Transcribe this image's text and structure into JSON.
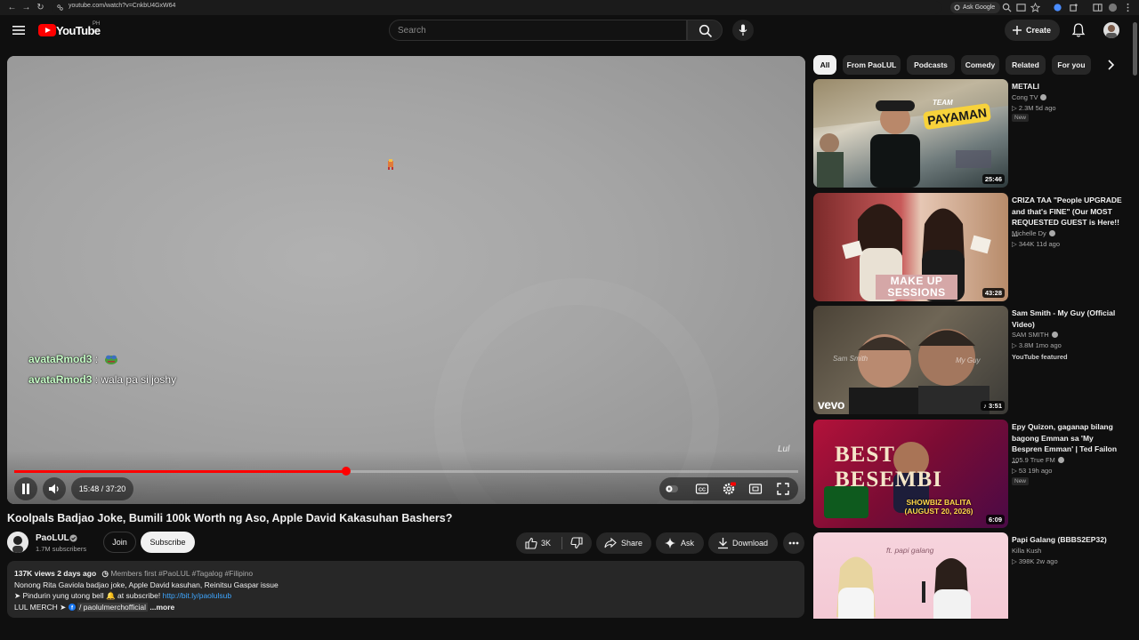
{
  "browser": {
    "url": "youtube.com/watch?v=CnkbU4GxW64",
    "ask_google": "Ask Google"
  },
  "masthead": {
    "logo_text": "YouTube",
    "region": "PH",
    "search_placeholder": "Search",
    "create_label": "Create"
  },
  "player": {
    "chat": [
      {
        "user": "avataRmod3",
        "message": ":"
      },
      {
        "user": "avataRmod3",
        "message": ": wala pa si joshy"
      }
    ],
    "watermark": "Lul",
    "current_time": "15:48",
    "duration": "37:20",
    "time_display": "15:48 / 37:20",
    "progress_fraction": 0.4232
  },
  "video": {
    "title": "Koolpals Badjao Joke, Bumili 100k Worth ng Aso, Apple David Kakasuhan Bashers?",
    "channel_name": "PaoLUL",
    "subscribers": "1.7M subscribers",
    "join_label": "Join",
    "subscribe_label": "Subscribe",
    "likes": "3K",
    "share_label": "Share",
    "ask_label": "Ask",
    "download_label": "Download"
  },
  "description": {
    "views_date": "137K views  2 days ago",
    "tags": "Members first  #PaoLUL #Tagalog #Filipino",
    "line1": "Nonong Rita Gaviola badjao joke, Apple David kasuhan, Reinitsu Gaspar issue",
    "line2_prefix": "➤ Pindurin yung utong bell",
    "line2_mid": " at subscribe! ",
    "line2_link": "http://bit.ly/paolulsub",
    "line3_prefix": "LUL MERCH ➤ ",
    "line3_link": "/ paolulmerchofficial",
    "more_label": "...more"
  },
  "chips": [
    "All",
    "From PaoLUL",
    "Podcasts",
    "Comedy",
    "Related",
    "For you"
  ],
  "recommendations": [
    {
      "title": "METALI",
      "channel": "Cong TV",
      "meta": "▷ 2.3M  5d ago",
      "badge": "New",
      "duration": "25:46",
      "thumb_text": "TEAM PAYAMAN"
    },
    {
      "title": "CRIZA TAA \"People UPGRADE and that's FINE\" (Our MOST REQUESTED GUEST is Here!! ...",
      "channel": "Michelle Dy",
      "meta": "▷ 344K  11d ago",
      "badge": "",
      "duration": "43:28",
      "thumb_text": "MAKE UP SESSIONS"
    },
    {
      "title": "Sam Smith - My Guy (Official Video)",
      "channel": "SAM SMITH",
      "meta": "▷ 3.8M  1mo ago",
      "badge": "YouTube featured",
      "duration": "♪ 3:51",
      "thumb_text": "vevo"
    },
    {
      "title": "Epy Quizon, gaganap bilang bagong Emman sa 'My Bespren Emman' | Ted Failon ...",
      "channel": "105.9 True FM",
      "meta": "▷ 53  19h ago",
      "badge": "New",
      "duration": "6:09",
      "thumb_text": "BEST BESEMBI",
      "thumb_sub": "SHOWBIZ BALITA (AUGUST 20, 2026)"
    },
    {
      "title": "Papi Galang (BBBS2EP32)",
      "channel": "Killa Kush",
      "meta": "▷ 398K  2w ago",
      "badge": "",
      "duration": "",
      "thumb_text": "ft. papi galang"
    }
  ],
  "colors": {
    "background": "#0f0f0f",
    "accent_red": "#ff0000",
    "link_blue": "#3ea6ff",
    "chip_bg": "#272727"
  }
}
